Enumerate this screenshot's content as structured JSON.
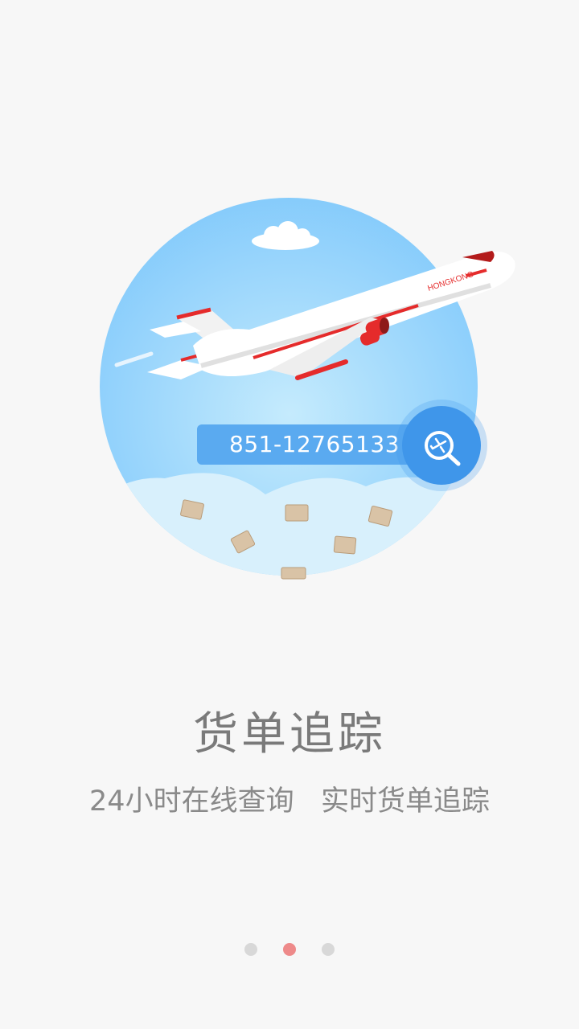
{
  "illustration": {
    "plane_livery": "HONGKONG",
    "tracking_number": "851-12765133",
    "search_icon": "search-plane-icon"
  },
  "title": "货单追踪",
  "subtitle": "24小时在线查询   实时货单追踪",
  "pager": {
    "count": 3,
    "active_index": 1
  },
  "colors": {
    "background": "#f7f7f7",
    "sky": "#8fd0fb",
    "accent_blue": "#3f96ea",
    "plane_red": "#e52b2b",
    "active_dot": "#ee8a8a",
    "inactive_dot": "#d8d8d8",
    "text_gray": "#7a7a7a"
  }
}
